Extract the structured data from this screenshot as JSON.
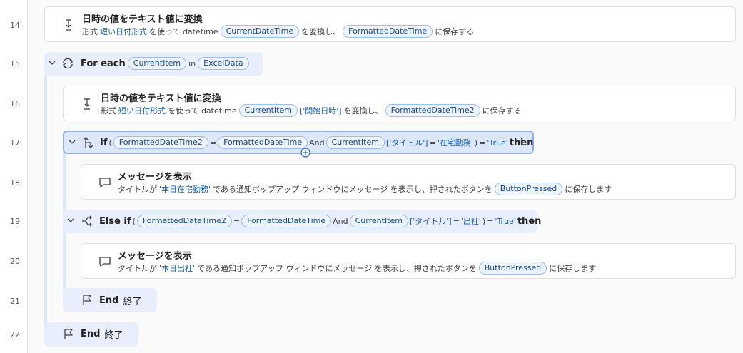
{
  "line_numbers": [
    "14",
    "15",
    "16",
    "17",
    "18",
    "19",
    "20",
    "21",
    "22"
  ],
  "steps": {
    "s14": {
      "title": "日時の値をテキスト値に変換",
      "p1": "形式",
      "format": "短い日付形式",
      "p2": "を使って datetime",
      "var_in": "CurrentDateTime",
      "p3": "を変換し、",
      "var_out": "FormattedDateTime",
      "p4": "に保存する"
    },
    "s15": {
      "keyword": "For each",
      "var": "CurrentItem",
      "in": "in",
      "collection": "ExcelData"
    },
    "s16": {
      "title": "日時の値をテキスト値に変換",
      "p1": "形式",
      "format": "短い日付形式",
      "p2": "を使って datetime",
      "var_in": "CurrentItem",
      "index": "['開始日時']",
      "p3": "を変換し、",
      "var_out": "FormattedDateTime2",
      "p4": "に保存する"
    },
    "s17": {
      "keyword": "If",
      "paren_open": "(",
      "var_a": "FormattedDateTime2",
      "eq": "=",
      "var_b": "FormattedDateTime",
      "and": "And",
      "var_c": "CurrentItem",
      "index": "['タイトル']",
      "eq2": "=",
      "literal": "'在宅勤務'",
      "paren_close": ")",
      "eq3": "=",
      "bool": "'True'",
      "then": "then",
      "more": "⋮"
    },
    "s18": {
      "title": "メッセージを表示",
      "p1": "タイトルが",
      "literal": "'本日在宅勤務'",
      "p2": "である通知ポップアップ ウィンドウにメッセージ を表示し、押されたボタンを",
      "var_out": "ButtonPressed",
      "p3": "に保存します"
    },
    "s19": {
      "keyword": "Else if",
      "paren_open": "(",
      "var_a": "FormattedDateTime2",
      "eq": "=",
      "var_b": "FormattedDateTime",
      "and": "And",
      "var_c": "CurrentItem",
      "index": "['タイトル']",
      "eq2": "=",
      "literal": "'出社'",
      "paren_close": ")",
      "eq3": "=",
      "bool": "'True'",
      "then": "then"
    },
    "s20": {
      "title": "メッセージを表示",
      "p1": "タイトルが",
      "literal": "'本日出社'",
      "p2": "である通知ポップアップ ウィンドウにメッセージ を表示し、押されたボタンを",
      "var_out": "ButtonPressed",
      "p3": "に保存します"
    },
    "s21": {
      "keyword": "End",
      "label": "終了"
    },
    "s22": {
      "keyword": "End",
      "label": "終了"
    }
  },
  "colors": {
    "accent": "#1a5fb4",
    "pill_border": "#9bbdea",
    "control_bg": "#e8eefb",
    "selected_border": "#8fb0ea"
  },
  "icons": [
    "convert-datetime-icon",
    "loop-icon",
    "if-branch-icon",
    "message-icon",
    "else-if-icon",
    "end-flag-icon",
    "chevron-down-icon",
    "more-options-icon",
    "add-action-icon"
  ]
}
